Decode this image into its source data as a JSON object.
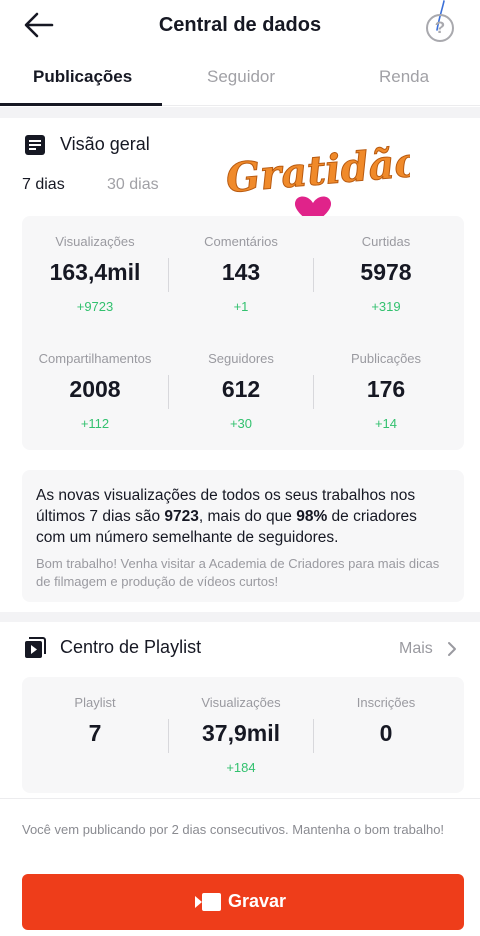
{
  "header": {
    "title": "Central de dados",
    "help_glyph": "?"
  },
  "tabs": [
    {
      "label": "Publicações",
      "active": true
    },
    {
      "label": "Seguidor",
      "active": false
    },
    {
      "label": "Renda",
      "active": false
    }
  ],
  "overview": {
    "title": "Visão geral",
    "periods": [
      "7 dias",
      "30 dias"
    ],
    "selected_period": "7 dias",
    "sticker_text": "Gratidão",
    "metrics": [
      {
        "label": "Visualizações",
        "value": "163,4mil",
        "delta": "+9723"
      },
      {
        "label": "Comentários",
        "value": "143",
        "delta": "+1"
      },
      {
        "label": "Curtidas",
        "value": "5978",
        "delta": "+319"
      },
      {
        "label": "Compartilhamentos",
        "value": "2008",
        "delta": "+112"
      },
      {
        "label": "Seguidores",
        "value": "612",
        "delta": "+30"
      },
      {
        "label": "Publicações",
        "value": "176",
        "delta": "+14"
      }
    ]
  },
  "insight": {
    "part1": "As novas visualizações de todos os seus trabalhos nos últimos 7 dias são ",
    "views": "9723",
    "part2": ", mais do que ",
    "percent": "98%",
    "part3": " de criadores com um número semelhante de seguidores.",
    "tip": "Bom trabalho! Venha visitar a Academia de Criadores para mais dicas de filmagem e produção de vídeos curtos!"
  },
  "playlist": {
    "title": "Centro de Playlist",
    "more_label": "Mais",
    "metrics": [
      {
        "label": "Playlist",
        "value": "7",
        "delta": ""
      },
      {
        "label": "Visualizações",
        "value": "37,9mil",
        "delta": "+184"
      },
      {
        "label": "Inscrições",
        "value": "0",
        "delta": ""
      }
    ]
  },
  "footer": {
    "notice": "Você vem publicando por 2 dias consecutivos. Mantenha o bom trabalho!",
    "record_label": "Gravar"
  },
  "colors": {
    "accent": "#ee3d1a",
    "positive": "#33c16f",
    "sticker_orange": "#f08a2a",
    "sticker_heart": "#e0238a"
  }
}
